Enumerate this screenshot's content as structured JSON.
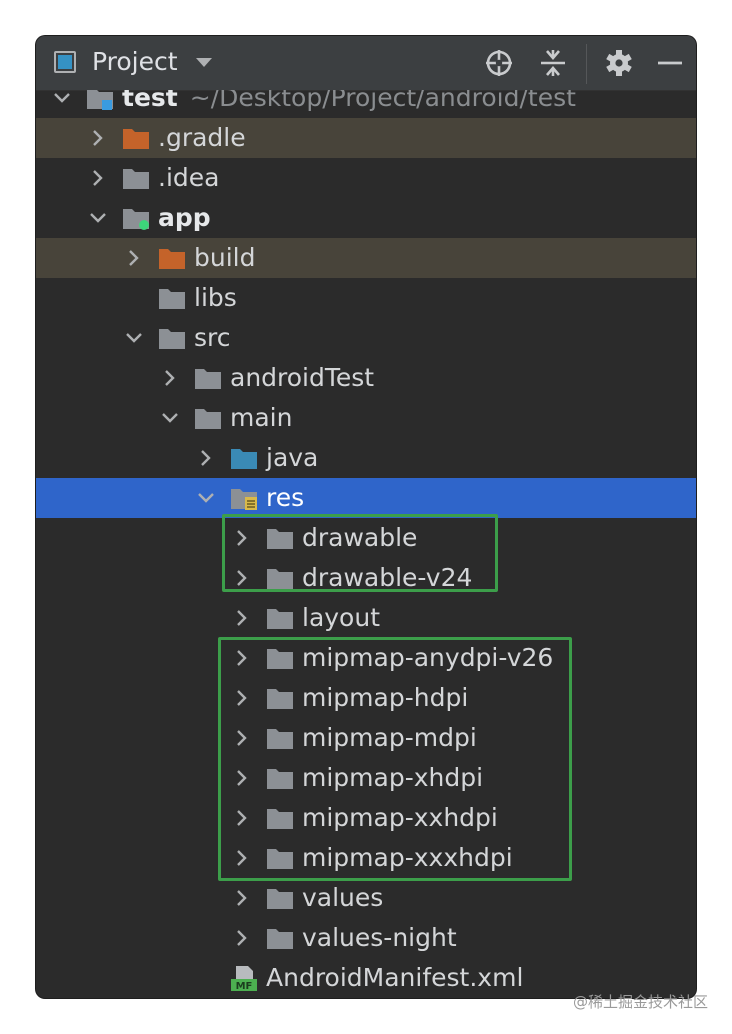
{
  "header": {
    "title": "Project",
    "icons": [
      "project-view-icon",
      "dropdown-caret-icon",
      "crosshair-icon",
      "collapse-all-icon",
      "gear-icon",
      "minimize-icon"
    ]
  },
  "colors": {
    "panel_bg": "#2b2b2b",
    "header_bg": "#3c3f41",
    "selection": "#2f65ca",
    "excluded_bg": "#48443a",
    "folder_gray": "#8c9095",
    "folder_orange": "#c4632a",
    "folder_blue": "#3a8ab5",
    "annotation_green": "#3c9e4a"
  },
  "tree": {
    "rows": [
      {
        "label": "test",
        "path": "~/Desktop/Project/android/test",
        "chevron": "down",
        "icon": "module-folder-icon",
        "bold": true
      },
      {
        "label": ".gradle",
        "chevron": "right",
        "icon": "excluded-folder-icon",
        "highlight": "excluded"
      },
      {
        "label": ".idea",
        "chevron": "right",
        "icon": "folder-icon"
      },
      {
        "label": "app",
        "chevron": "down",
        "icon": "android-module-icon",
        "bold": true
      },
      {
        "label": "build",
        "chevron": "right",
        "icon": "excluded-folder-icon",
        "highlight": "excluded"
      },
      {
        "label": "libs",
        "chevron": "none",
        "icon": "folder-icon"
      },
      {
        "label": "src",
        "chevron": "down",
        "icon": "folder-icon"
      },
      {
        "label": "androidTest",
        "chevron": "right",
        "icon": "folder-icon"
      },
      {
        "label": "main",
        "chevron": "down",
        "icon": "folder-icon"
      },
      {
        "label": "java",
        "chevron": "right",
        "icon": "source-folder-icon"
      },
      {
        "label": "res",
        "chevron": "down",
        "icon": "resource-folder-icon",
        "selected": true
      },
      {
        "label": "drawable",
        "chevron": "right",
        "icon": "folder-icon"
      },
      {
        "label": "drawable-v24",
        "chevron": "right",
        "icon": "folder-icon"
      },
      {
        "label": "layout",
        "chevron": "right",
        "icon": "folder-icon"
      },
      {
        "label": "mipmap-anydpi-v26",
        "chevron": "right",
        "icon": "folder-icon"
      },
      {
        "label": "mipmap-hdpi",
        "chevron": "right",
        "icon": "folder-icon"
      },
      {
        "label": "mipmap-mdpi",
        "chevron": "right",
        "icon": "folder-icon"
      },
      {
        "label": "mipmap-xhdpi",
        "chevron": "right",
        "icon": "folder-icon"
      },
      {
        "label": "mipmap-xxhdpi",
        "chevron": "right",
        "icon": "folder-icon"
      },
      {
        "label": "mipmap-xxxhdpi",
        "chevron": "right",
        "icon": "folder-icon"
      },
      {
        "label": "values",
        "chevron": "right",
        "icon": "folder-icon"
      },
      {
        "label": "values-night",
        "chevron": "right",
        "icon": "folder-icon"
      },
      {
        "label": "AndroidManifest.xml",
        "chevron": "none",
        "icon": "manifest-file-icon"
      }
    ]
  },
  "watermark": "@稀土掘金技术社区"
}
